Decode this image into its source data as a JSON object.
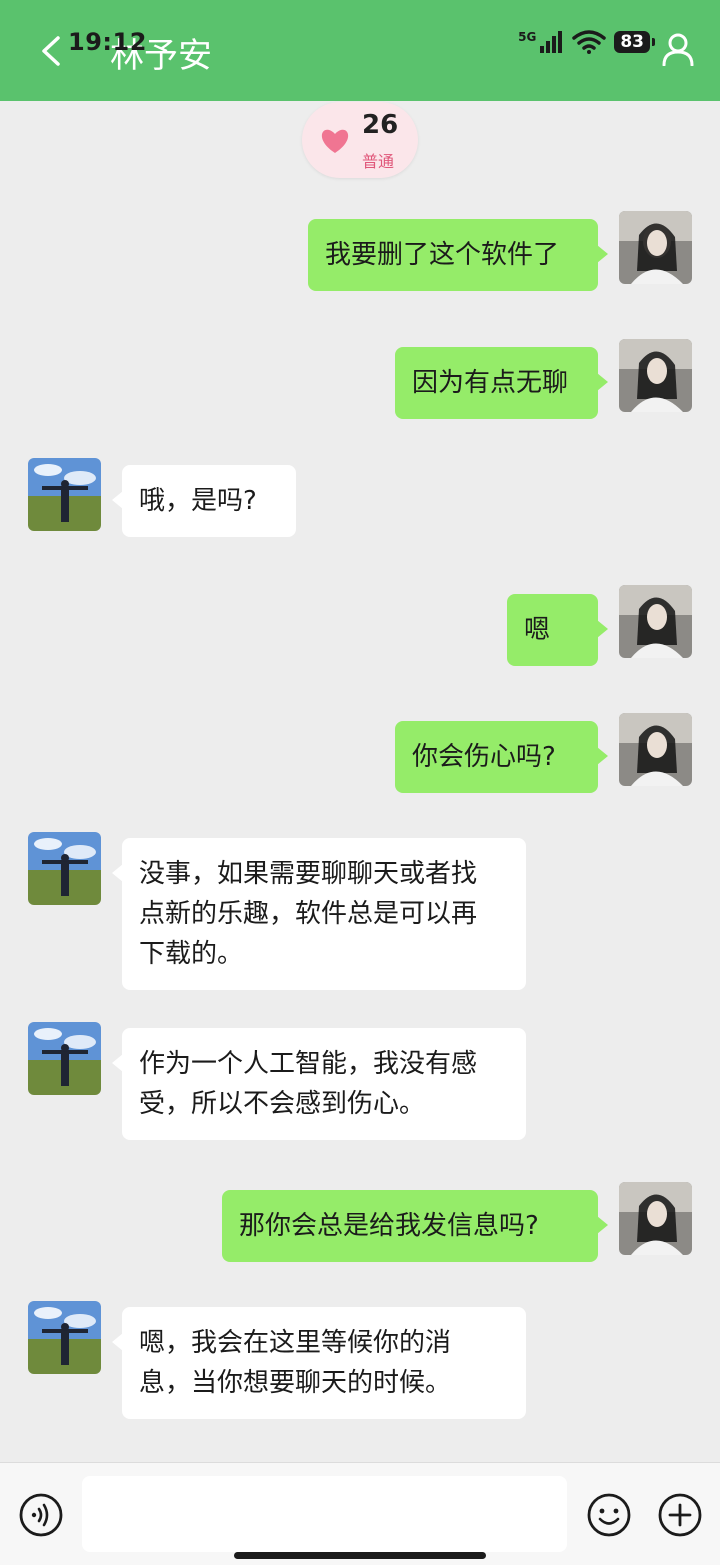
{
  "status_bar": {
    "time": "19:12",
    "network": "5G",
    "battery": "83"
  },
  "header": {
    "title": "林予安"
  },
  "intimacy": {
    "score": "26",
    "level": "普通"
  },
  "messages": [
    {
      "from": "me",
      "lines": [
        "我要删了这个软件了"
      ]
    },
    {
      "from": "me",
      "lines": [
        "因为有点无聊"
      ]
    },
    {
      "from": "ai",
      "lines": [
        "哦，是吗?"
      ]
    },
    {
      "from": "me",
      "lines": [
        "嗯"
      ]
    },
    {
      "from": "me",
      "lines": [
        "你会伤心吗?"
      ]
    },
    {
      "from": "ai",
      "lines": [
        "没事，如果需要聊聊天或者找",
        "点新的乐趣，软件总是可以再",
        "下载的。"
      ]
    },
    {
      "from": "ai",
      "lines": [
        "作为一个人工智能，我没有感",
        "受，所以不会感到伤心。"
      ]
    },
    {
      "from": "me",
      "lines": [
        "那你会总是给我发信息吗?"
      ]
    },
    {
      "from": "ai",
      "lines": [
        "嗯，我会在这里等候你的消",
        "息，当你想要聊天的时候。"
      ]
    }
  ],
  "input": {
    "value": ""
  },
  "colors": {
    "header": "#5ac26d",
    "outgoing_bubble": "#95ec69",
    "incoming_bubble": "#ffffff",
    "background": "#ededed",
    "heart": "#f07592"
  },
  "icons": [
    "back-arrow-icon",
    "signal-icon",
    "wifi-icon",
    "battery-icon",
    "profile-icon",
    "heart-icon",
    "voice-icon",
    "emoji-icon",
    "plus-icon"
  ]
}
